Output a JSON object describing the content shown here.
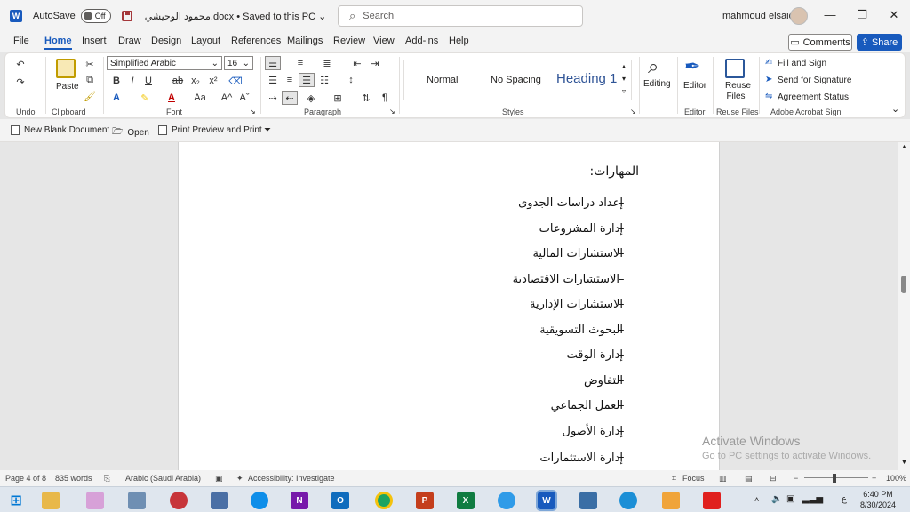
{
  "titlebar": {
    "app_icon": "W",
    "autosave_label": "AutoSave",
    "autosave_state": "Off",
    "document_title": "محمود الوحيشي.docx • Saved to this PC ⌄",
    "search_placeholder": "Search",
    "user_name": "mahmoud elsaid",
    "minimize": "—",
    "restore": "❐",
    "close": "✕"
  },
  "menu": {
    "tabs": [
      "File",
      "Home",
      "Insert",
      "Draw",
      "Design",
      "Layout",
      "References",
      "Mailings",
      "Review",
      "View",
      "Add-ins",
      "Help"
    ],
    "active": "Home",
    "comments_label": "Comments",
    "share_label": "Share"
  },
  "ribbon": {
    "undo_group": "Undo",
    "clipboard_group": "Clipboard",
    "paste_label": "Paste",
    "font_group": "Font",
    "font_name": "Simplified Arabic",
    "font_size": "16",
    "paragraph_group": "Paragraph",
    "styles_group": "Styles",
    "styles": [
      "Normal",
      "No Spacing",
      "Heading 1"
    ],
    "editing_label": "Editing",
    "editor_label": "Editor",
    "editor_group": "Editor",
    "reuse_files_label": "Reuse Files",
    "reuse_files_group": "Reuse Files",
    "fill_sign": "Fill and Sign",
    "send_signature": "Send for Signature",
    "agreement_status": "Agreement Status",
    "acrobat_group": "Adobe Acrobat Sign",
    "bold": "B",
    "italic": "I",
    "underline": "U",
    "strike": "ab",
    "subscript": "x₂",
    "superscript": "x²",
    "font_color_a": "A",
    "case_label": "Aa",
    "grow_font": "A^",
    "shrink_font": "Aˇ",
    "pilcrow": "¶"
  },
  "quick_access": {
    "new_blank": "New Blank Document",
    "open": "Open",
    "print_preview": "Print Preview and Print"
  },
  "document": {
    "section_heading": "المهارات:",
    "bullet_char": "–",
    "skills": [
      "إعداد دراسات الجدوى",
      "إدارة المشروعات",
      "الاستشارات المالية",
      "الاستشارات الاقتصادية",
      "الاستشارات الإدارية",
      "البحوث التسويقية",
      "إدارة الوقت",
      "التفاوض",
      "العمل الجماعي",
      "إدارة الأصول",
      "إدارة الاستثمارات"
    ]
  },
  "watermark": {
    "line1": "Activate Windows",
    "line2": "Go to PC settings to activate Windows."
  },
  "statusbar": {
    "page": "Page 4 of 8",
    "words": "835 words",
    "language": "Arabic (Saudi Arabia)",
    "accessibility": "Accessibility: Investigate",
    "focus": "Focus",
    "zoom": "100%"
  },
  "taskbar": {
    "time": "6:40 PM",
    "date": "8/30/2024",
    "lang": "ع"
  },
  "colors": {
    "accent": "#185abd",
    "powerpoint": "#c43e1c",
    "excel": "#107c41",
    "onenote": "#7719aa",
    "outlook": "#0f6cbd"
  }
}
